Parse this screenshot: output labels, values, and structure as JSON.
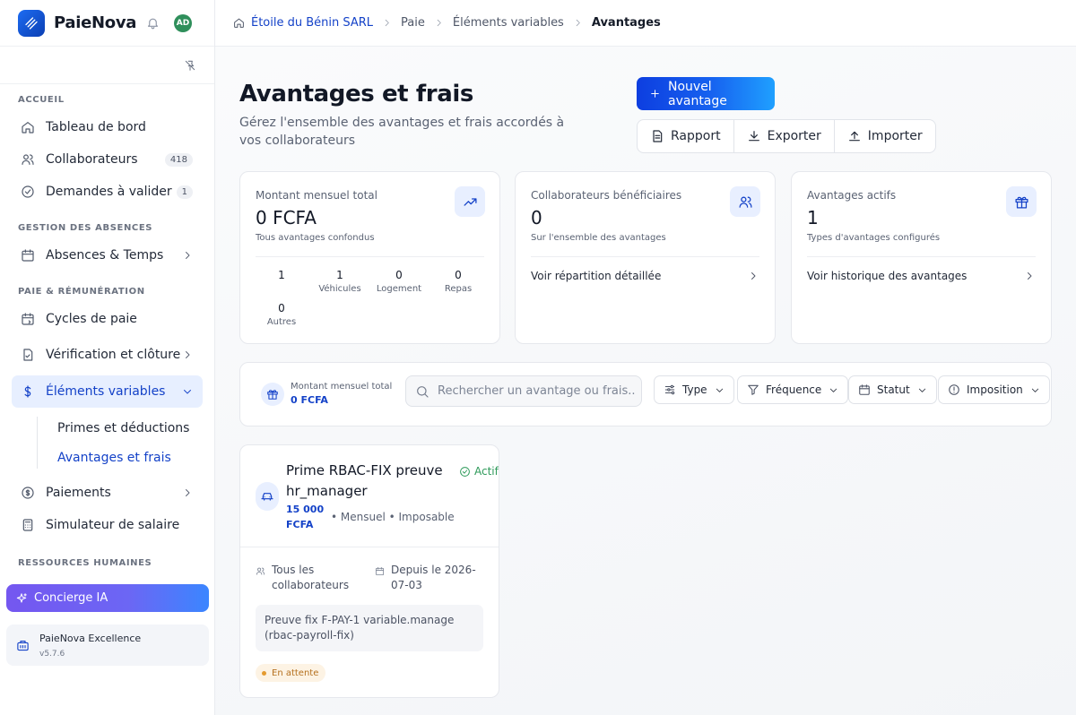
{
  "app": {
    "name": "PaieNova",
    "user_initials": "AD"
  },
  "sidebar": {
    "sections": {
      "accueil": "ACCUEIL",
      "absences": "GESTION DES ABSENCES",
      "paie": "PAIE & RÉMUNÉRATION",
      "rh": "RESSOURCES HUMAINES"
    },
    "items": {
      "dashboard": "Tableau de bord",
      "collaborateurs": "Collaborateurs",
      "collaborateurs_count": "418",
      "demandes": "Demandes à valider",
      "demandes_count": "1",
      "absences": "Absences & Temps",
      "cycles": "Cycles de paie",
      "verification": "Vérification et clôture",
      "elements": "Éléments variables",
      "primes": "Primes et déductions",
      "avantages": "Avantages et frais",
      "paiements": "Paiements",
      "simulateur": "Simulateur de salaire"
    },
    "concierge": "Concierge IA",
    "plan": {
      "name": "PaieNova Excellence",
      "version": "v5.7.6"
    }
  },
  "breadcrumb": [
    "Étoile du Bénin SARL",
    "Paie",
    "Éléments variables",
    "Avantages"
  ],
  "header": {
    "title": "Avantages et frais",
    "subtitle": "Gérez l'ensemble des avantages et frais accordés à vos collaborateurs",
    "new_button": "Nouvel avantage",
    "report": "Rapport",
    "export": "Exporter",
    "import": "Importer"
  },
  "cards": {
    "total": {
      "label": "Montant mensuel total",
      "value": "0 FCFA",
      "note": "Tous avantages confondus",
      "stats": [
        {
          "n": "1",
          "l": ""
        },
        {
          "n": "1",
          "l": "Véhicules"
        },
        {
          "n": "0",
          "l": "Logement"
        },
        {
          "n": "0",
          "l": "Repas"
        },
        {
          "n": "0",
          "l": "Autres"
        }
      ]
    },
    "beneficiaires": {
      "label": "Collaborateurs bénéficiaires",
      "value": "0",
      "note": "Sur l'ensemble des avantages",
      "link": "Voir répartition détaillée"
    },
    "actifs": {
      "label": "Avantages actifs",
      "value": "1",
      "note": "Types d'avantages configurés",
      "link": "Voir historique des avantages"
    }
  },
  "filters": {
    "total_label": "Montant mensuel total",
    "total_value": "0 FCFA",
    "search_placeholder": "Rechercher un avantage ou frais...",
    "type": "Type",
    "frequence": "Fréquence",
    "statut": "Statut",
    "imposition": "Imposition"
  },
  "advantage": {
    "name": "Prime RBAC-FIX preuve hr_manager",
    "status": "Actif",
    "amount": "15 000 FCFA",
    "meta": "•  Mensuel  •  Imposable",
    "scope": "Tous les collaborateurs",
    "since": "Depuis le 2026-07-03",
    "note": "Preuve fix F-PAY-1 variable.manage (rbac-payroll-fix)",
    "pending": "En attente"
  }
}
